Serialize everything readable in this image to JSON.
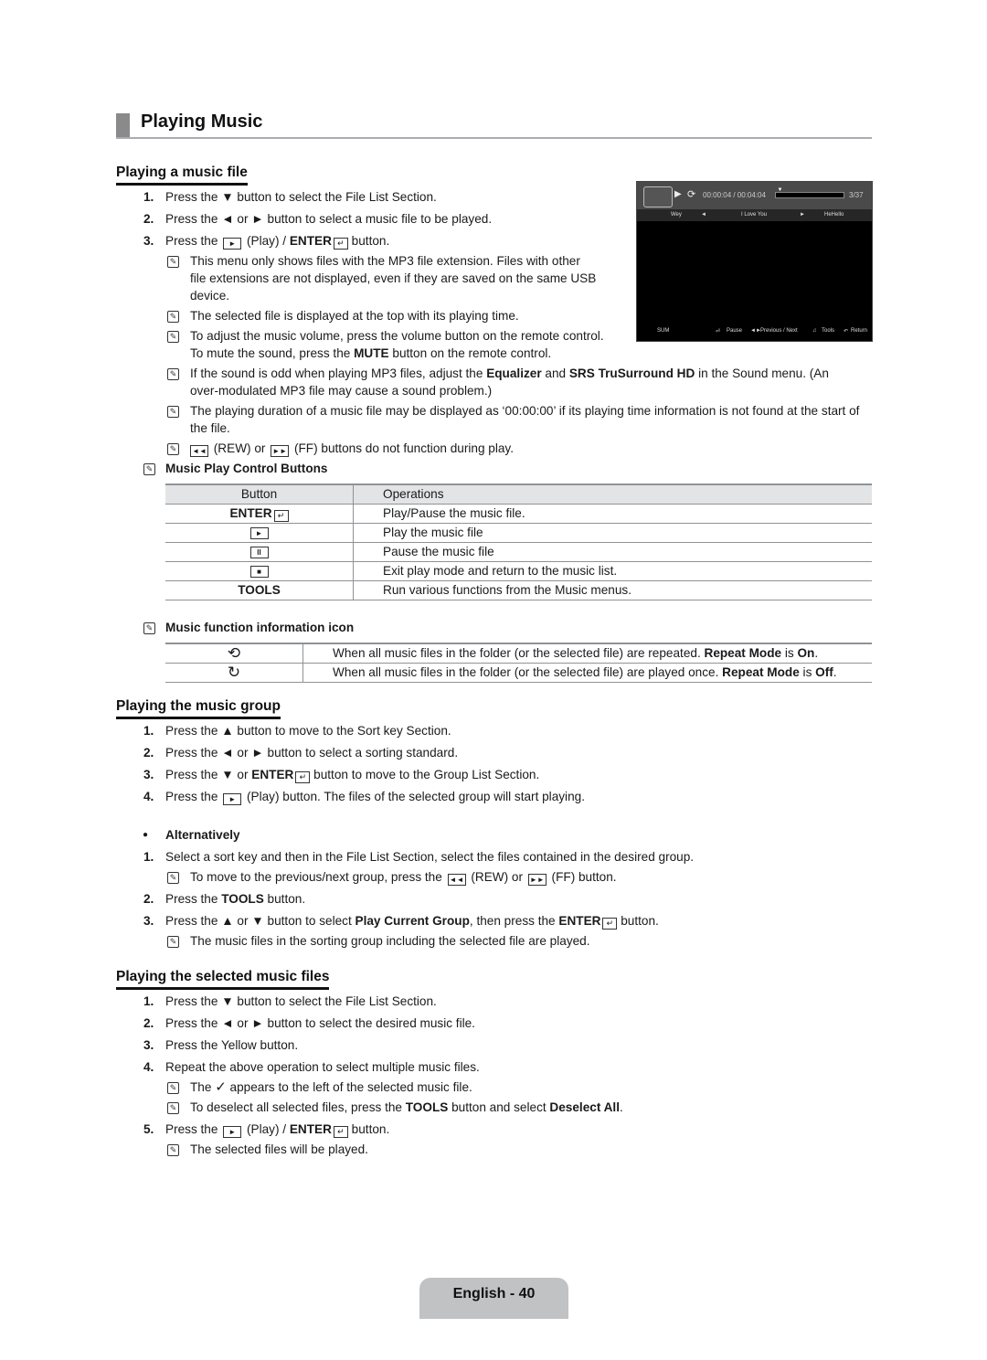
{
  "title": "Playing Music",
  "sections": {
    "music_file": {
      "heading": "Playing a music file",
      "steps": [
        {
          "num": "1.",
          "pre": "Press the ▼ button to select the File List Section."
        },
        {
          "num": "2.",
          "pre": "Press the ◄ or ► button to select a music file to be played."
        },
        {
          "num": "3.",
          "pre": "Press the",
          "play_icon": "►",
          "mid": " (Play) / ",
          "bold": "ENTER",
          "enter_icon": "↵",
          "post": " button."
        }
      ],
      "notes": [
        {
          "lines": [
            "This menu only shows files with the MP3 file extension. Files with other",
            "file extensions are not displayed, even if they are saved on the same USB",
            "device."
          ]
        },
        {
          "lines": [
            "The selected file is displayed at the top with its playing time."
          ]
        },
        {
          "line1": "To adjust the music volume, press the volume button on the remote control.",
          "line2_pre": "To mute the sound, press the ",
          "line2_bold": "MUTE",
          "line2_post": " button on the remote control."
        },
        {
          "l1_pre": "If the sound is odd when playing MP3 files, adjust the ",
          "l1_b1": "Equalizer",
          "l1_mid": " and ",
          "l1_b2": "SRS TruSurround HD",
          "l1_post": " in the Sound menu. (An",
          "line2": "over-modulated MP3 file may cause a sound problem.)"
        },
        {
          "line1": "The playing duration of a music file may be displayed as ‘00:00:00’ if its playing time information is not found at the start of",
          "line2": "the file."
        },
        {
          "rew_icon": "◄◄",
          "rew_label": " (REW) or ",
          "ff_icon": "►►",
          "ff_label": " (FF) buttons do not function during play."
        }
      ],
      "control_table": {
        "title": "Music Play Control Buttons",
        "headers": [
          "Button",
          "Operations"
        ],
        "rows": [
          {
            "button": "ENTER",
            "button_icon": "↵",
            "operation": "Play/Pause the music file."
          },
          {
            "button_icon": "►",
            "operation": "Play the music file"
          },
          {
            "button_icon": "II",
            "operation": "Pause the music file"
          },
          {
            "button_icon": "■",
            "operation": "Exit play mode and return to the music list."
          },
          {
            "button": "TOOLS",
            "operation": "Run various functions from the Music menus."
          }
        ]
      },
      "icon_table": {
        "title": "Music function information icon",
        "rows": [
          {
            "icon": "repeat-on",
            "glyph": "⟲",
            "pre": "When all music files in the folder (or the selected file) are repeated. ",
            "b1": "Repeat Mode",
            "mid": " is ",
            "b2": "On",
            "post": "."
          },
          {
            "icon": "repeat-off",
            "glyph": "↻",
            "pre": "When all music files in the folder (or the selected file) are played once. ",
            "b1": "Repeat Mode",
            "mid": " is ",
            "b2": "Off",
            "post": "."
          }
        ]
      }
    },
    "music_group": {
      "heading": "Playing the music group",
      "steps": [
        {
          "num": "1.",
          "text": "Press the ▲ button to move to the Sort key Section."
        },
        {
          "num": "2.",
          "text": "Press the ◄ or ► button to select a sorting standard."
        },
        {
          "num": "3.",
          "pre": "Press the ▼ or ",
          "bold": "ENTER",
          "post": " button to move to the Group List Section."
        },
        {
          "num": "4.",
          "pre": "Press the ",
          "post": " (Play) button. The files of the selected group will start playing."
        }
      ],
      "alternatively": {
        "bullet": "●",
        "label": "Alternatively",
        "steps": [
          {
            "num": "1.",
            "text": "Select a sort key and then in the File List Section, select the files contained in the desired group."
          },
          {
            "num": "2.",
            "pre": "Press the ",
            "bold": "TOOLS",
            "post": " button."
          },
          {
            "num": "3.",
            "pre": "Press the ▲ or ▼ button to select ",
            "b1": "Play Current Group",
            "mid": ", then press the ",
            "b2": "ENTER",
            "post": " button."
          }
        ],
        "note1": {
          "pre": "To move to the previous/next group, press the ",
          "mid": " (REW) or ",
          "post": " (FF) button."
        },
        "note2": "The music files in the sorting group including the selected file are played."
      }
    },
    "selected_files": {
      "heading": "Playing the selected music files",
      "steps": [
        {
          "num": "1.",
          "text": "Press the ▼ button to select the File List Section."
        },
        {
          "num": "2.",
          "text": "Press the ◄ or ► button to select the desired music file."
        },
        {
          "num": "3.",
          "text": "Press the Yellow button."
        },
        {
          "num": "4.",
          "text": "Repeat the above operation to select multiple music files."
        },
        {
          "num": "5.",
          "pre": "Press the ",
          "mid": " (Play) / ",
          "bold": "ENTER",
          "post": " button."
        }
      ],
      "note_check": {
        "pre": "The ",
        "check": "✓",
        "post": " appears to the left of the selected music file."
      },
      "note_deselect": {
        "pre": "To deselect all selected files, press the ",
        "b1": "TOOLS",
        "mid": " button and select ",
        "b2": "Deselect All",
        "post": "."
      },
      "note_played": "The selected files will be played."
    }
  },
  "tv_screen": {
    "elapsed": "00:00:04 / 00:04:04",
    "track_count": "3/37",
    "progress_fraction": 0.02,
    "list": {
      "prev": "Wey",
      "current": "I Love You",
      "next": "HeHello"
    },
    "bottom": {
      "left": "SUM",
      "pause": "Pause",
      "prev_next": "Previous / Next",
      "tools": "Tools",
      "return": "Return"
    }
  },
  "footer": {
    "page_label": "English - 40"
  }
}
